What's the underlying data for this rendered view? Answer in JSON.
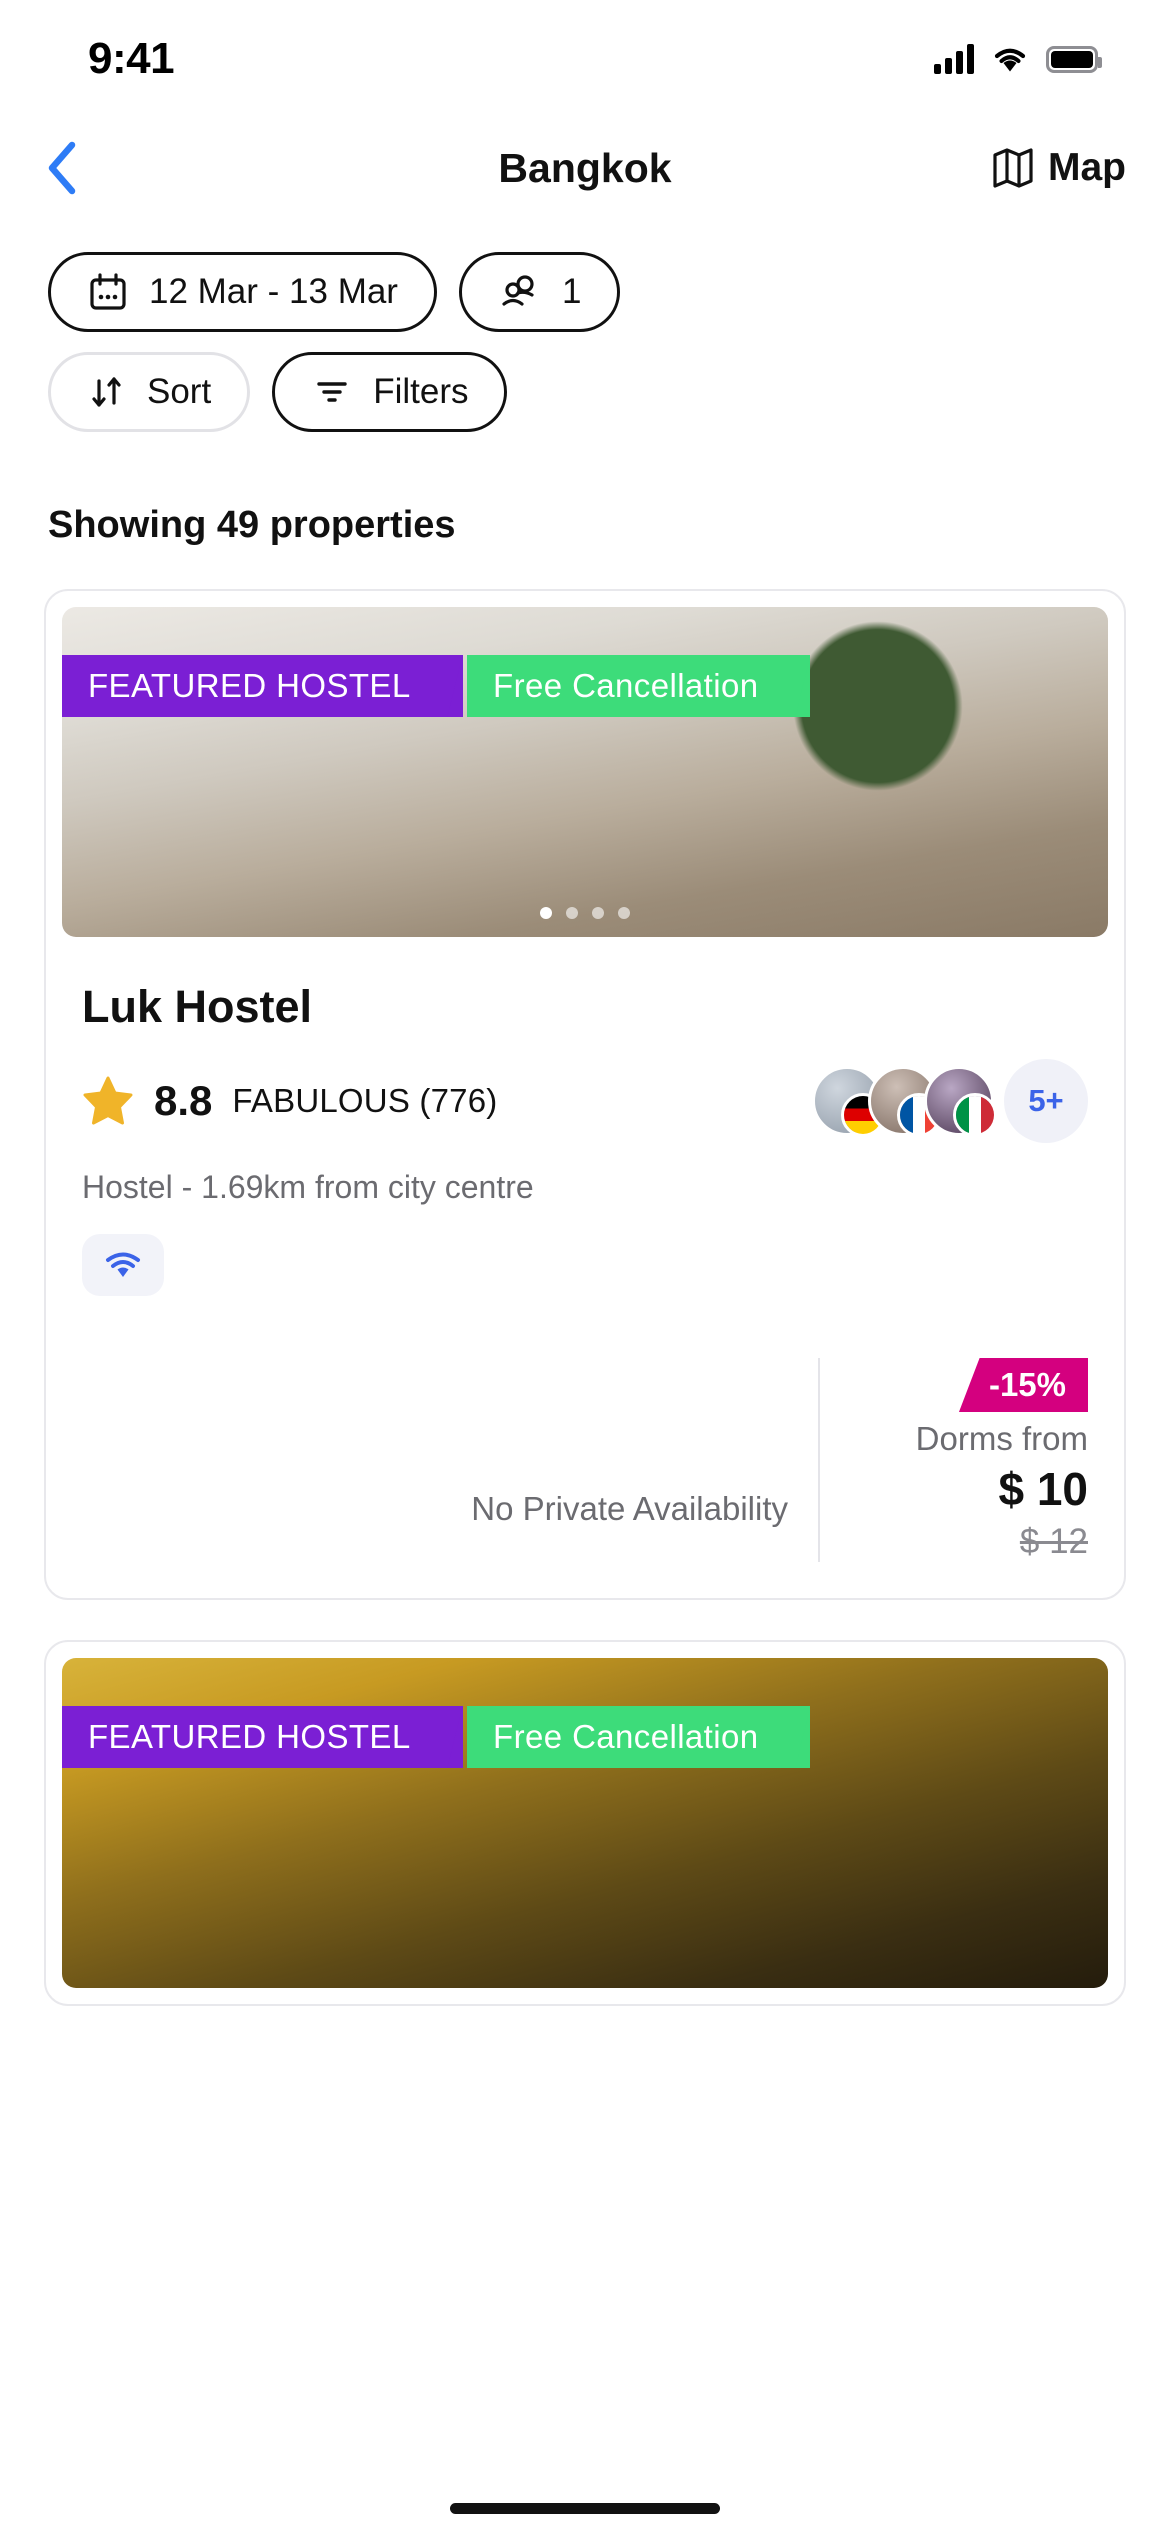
{
  "status_bar": {
    "time": "9:41",
    "signal_icon": "cellular-signal-icon",
    "wifi_icon": "wifi-icon",
    "battery_icon": "battery-icon"
  },
  "nav": {
    "back_icon": "chevron-left-icon",
    "title": "Bangkok",
    "map_label": "Map",
    "map_icon": "map-icon",
    "accent_color": "#2e7cf6"
  },
  "filters": {
    "dates_label": "12 Mar - 13 Mar",
    "dates_icon": "calendar-icon",
    "guests_label": "1",
    "guests_icon": "people-icon",
    "sort_label": "Sort",
    "sort_icon": "sort-arrows-icon",
    "filters_label": "Filters",
    "filters_icon": "filter-funnel-icon"
  },
  "results": {
    "count_label": "Showing 49 properties"
  },
  "cards": [
    {
      "featured_badge": "FEATURED HOSTEL",
      "cancellation_badge": "Free Cancellation",
      "featured_color": "#7B1FD4",
      "cancellation_color": "#3DDC7A",
      "name": "Luk Hostel",
      "star_icon": "star-icon",
      "score": "8.8",
      "score_text": "FABULOUS (776)",
      "avatar_flags": [
        "germany-flag",
        "france-flag",
        "italy-flag"
      ],
      "more_guests": "5+",
      "meta": "Hostel  -  1.69km from city centre",
      "amenities": [
        "wifi-icon"
      ],
      "no_availability": "No Private Availability",
      "discount": "-15%",
      "discount_color": "#D4007F",
      "dorms_from": "Dorms from",
      "price": "$ 10",
      "price_old": "$ 12"
    },
    {
      "featured_badge": "FEATURED HOSTEL",
      "cancellation_badge": "Free Cancellation",
      "featured_color": "#7B1FD4",
      "cancellation_color": "#3DDC7A"
    }
  ]
}
